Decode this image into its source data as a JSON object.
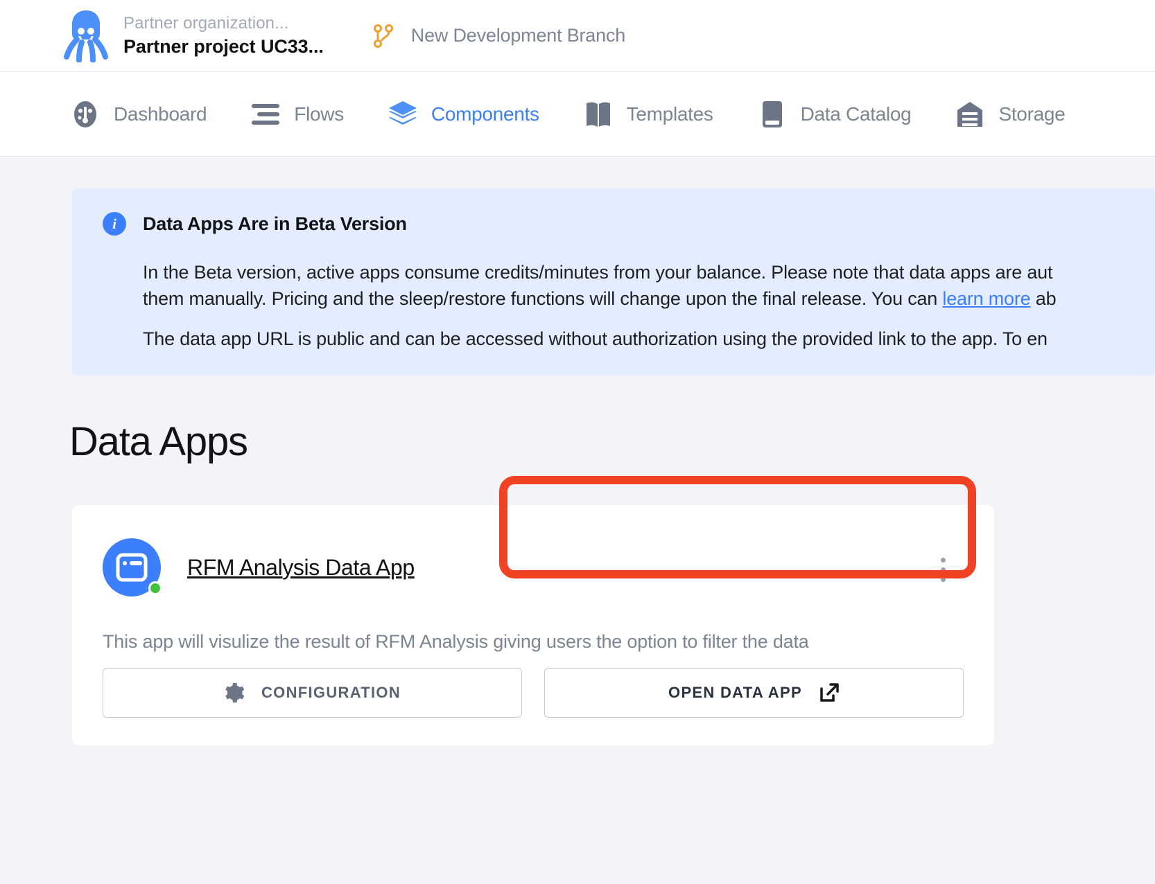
{
  "topbar": {
    "logo_icon": "keboola-octopus-icon",
    "organization": "Partner organization...",
    "project": "Partner project UC33...",
    "branch_icon": "branch-icon",
    "branch": "New Development Branch"
  },
  "nav": {
    "items": [
      {
        "label": "Dashboard",
        "icon": "gauge-icon",
        "active": false
      },
      {
        "label": "Flows",
        "icon": "flows-lines-icon",
        "active": false
      },
      {
        "label": "Components",
        "icon": "layers-icon",
        "active": true
      },
      {
        "label": "Templates",
        "icon": "open-book-icon",
        "active": false
      },
      {
        "label": "Data Catalog",
        "icon": "book-icon",
        "active": false
      },
      {
        "label": "Storage",
        "icon": "warehouse-icon",
        "active": false
      }
    ]
  },
  "banner": {
    "icon": "info-icon",
    "icon_glyph": "i",
    "title": "Data Apps Are in Beta Version",
    "paragraph1_before": "In the Beta version, active apps consume credits/minutes from your balance. Please note that data apps are aut",
    "paragraph1_line2_before": "them manually. Pricing and the sleep/restore functions will change upon the final release. You can ",
    "link_text": "learn more",
    "paragraph1_line2_after": " ab",
    "paragraph2": "The data app URL is public and can be accessed without authorization using the provided link to the app. To en"
  },
  "page": {
    "title": "Data Apps"
  },
  "app_card": {
    "avatar_icon": "data-app-window-icon",
    "status": "running",
    "status_color": "#42c23f",
    "title": "RFM Analysis Data App",
    "menu_icon": "kebab-menu-icon",
    "description": "This app will visulize the result of RFM Analysis giving users the option to filter the data",
    "buttons": [
      {
        "label": "CONFIGURATION",
        "icon": "gear-icon"
      },
      {
        "label": "OPEN DATA APP",
        "icon": "external-link-icon"
      }
    ]
  },
  "annotation": {
    "color": "#ef4324",
    "target": "open-data-app-button"
  }
}
